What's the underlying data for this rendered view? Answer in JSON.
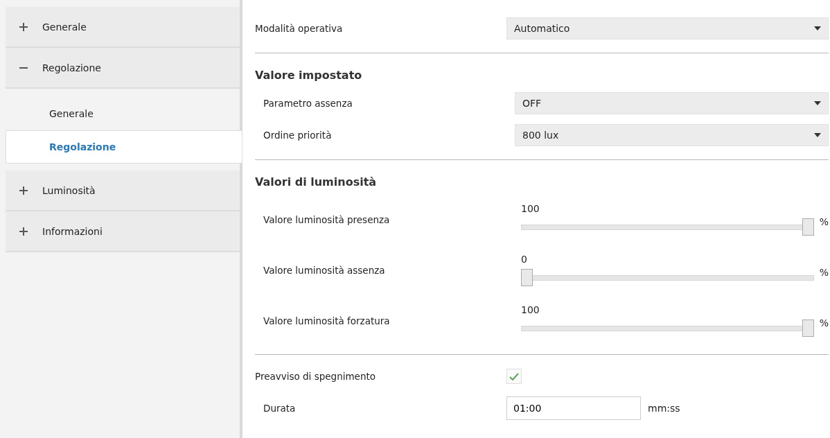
{
  "sidebar": {
    "items": [
      {
        "label": "Generale",
        "expanded": false
      },
      {
        "label": "Regolazione",
        "expanded": true,
        "children": [
          {
            "label": "Generale",
            "selected": false
          },
          {
            "label": "Regolazione",
            "selected": true
          }
        ]
      },
      {
        "label": "Luminosità",
        "expanded": false
      },
      {
        "label": "Informazioni",
        "expanded": false
      }
    ]
  },
  "sections": [
    {
      "rows": [
        {
          "kind": "dropdown",
          "label": "Modalità operativa",
          "value": "Automatico"
        }
      ]
    },
    {
      "heading": "Valore impostato",
      "rows": [
        {
          "kind": "dropdown",
          "label": "Parametro assenza",
          "value": "OFF"
        },
        {
          "kind": "dropdown",
          "label": "Ordine priorità",
          "value": "800 lux"
        }
      ]
    },
    {
      "heading": "Valori di luminosità",
      "rows": [
        {
          "kind": "slider",
          "label": "Valore luminosità presenza",
          "value": "100",
          "level": 1,
          "unit": "%"
        },
        {
          "kind": "slider",
          "label": "Valore luminosità assenza",
          "value": "0",
          "level": 0,
          "unit": "%"
        },
        {
          "kind": "slider",
          "label": "Valore luminosità forzatura",
          "value": "100",
          "level": 1,
          "unit": "%"
        }
      ]
    },
    {
      "rows": [
        {
          "kind": "checkbox",
          "label": "Preavviso di spegnimento",
          "checked": true,
          "children": [
            {
              "kind": "text_input",
              "label": "Durata",
              "value": "01:00",
              "unit": "mm:ss"
            }
          ]
        }
      ]
    }
  ]
}
